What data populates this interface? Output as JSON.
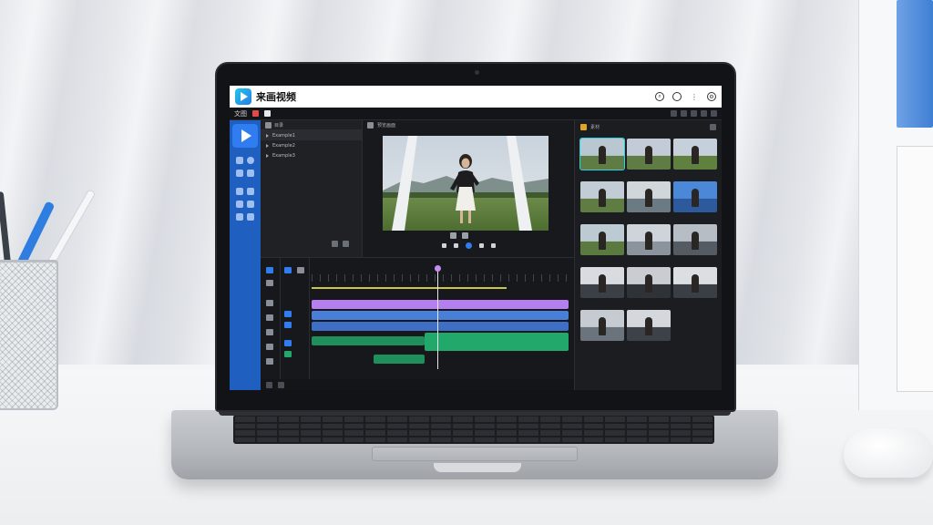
{
  "app": {
    "title": "来画视频",
    "window_icons": [
      "search-icon",
      "chat-icon",
      "more-icon",
      "settings-icon"
    ]
  },
  "menubar": {
    "label": "文图"
  },
  "colors": {
    "brand_blue": "#2f7df0",
    "rail_blue": "#1f5fbf",
    "selection_cyan": "#2ad4e6",
    "track_purple": "#b57ff0",
    "track_blue": "#4a7fd9",
    "track_green": "#22a86a"
  },
  "left_panel": {
    "header": "目录",
    "items": [
      "Example1",
      "Example2",
      "Example3"
    ]
  },
  "preview": {
    "header": "预览画面"
  },
  "right_panel": {
    "header": "素材"
  },
  "timeline": {
    "tracks": [
      {
        "kind": "text",
        "color": "#b57ff0"
      },
      {
        "kind": "video",
        "color": "#4a7fd9"
      },
      {
        "kind": "video",
        "color": "#4a7fd9"
      },
      {
        "kind": "audio",
        "color": "#22a86a"
      },
      {
        "kind": "audio",
        "color": "#22a86a"
      }
    ]
  }
}
